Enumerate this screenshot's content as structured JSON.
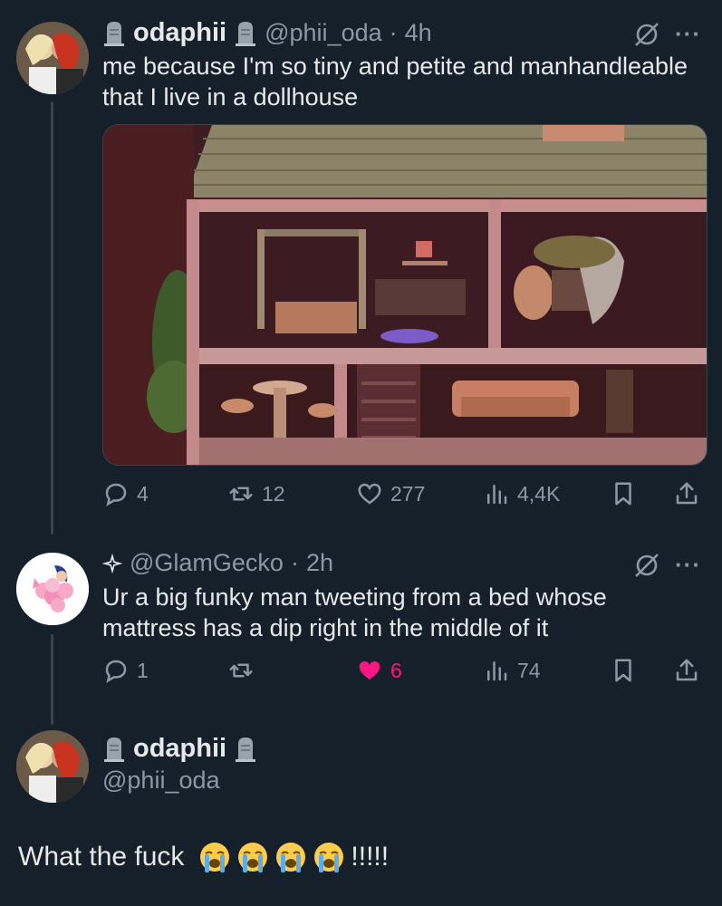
{
  "tweet1": {
    "display_name": "odaphii",
    "handle": "@phii_oda",
    "separator": "·",
    "time": "4h",
    "text_line1": "me because I'm so tiny and petite and manhandleable",
    "text_line2": "that I live in a dollhouse",
    "more_label": "···",
    "stats": {
      "replies": "4",
      "reposts": "12",
      "likes": "277",
      "views": "4,4K"
    }
  },
  "tweet2": {
    "handle": "@GlamGecko",
    "separator": "·",
    "time": "2h",
    "text_line1": "Ur a big funky man tweeting from a bed whose",
    "text_line2": "mattress has a dip right in the middle of it",
    "more_label": "···",
    "stats": {
      "replies": "1",
      "reposts": "",
      "likes": "6",
      "views": "74"
    },
    "liked": true
  },
  "tweet3": {
    "display_name": "odaphii",
    "handle": "@phii_oda",
    "text": "What the fuck",
    "suffix": "!!!!!"
  },
  "icons": {
    "reply": "reply-icon",
    "repost": "repost-icon",
    "like": "heart-icon",
    "views": "views-icon",
    "bookmark": "bookmark-icon",
    "share": "share-icon",
    "grok": "grok-icon",
    "more": "more-icon",
    "tombstone": "tombstone-icon",
    "sparkle": "sparkle-icon",
    "emoji": "loudly-crying-face-emoji"
  },
  "colors": {
    "background": "#15202b",
    "text": "#e7e9ea",
    "muted": "#8b98a5",
    "like_active": "#f91880",
    "thread_line": "#38444d"
  }
}
